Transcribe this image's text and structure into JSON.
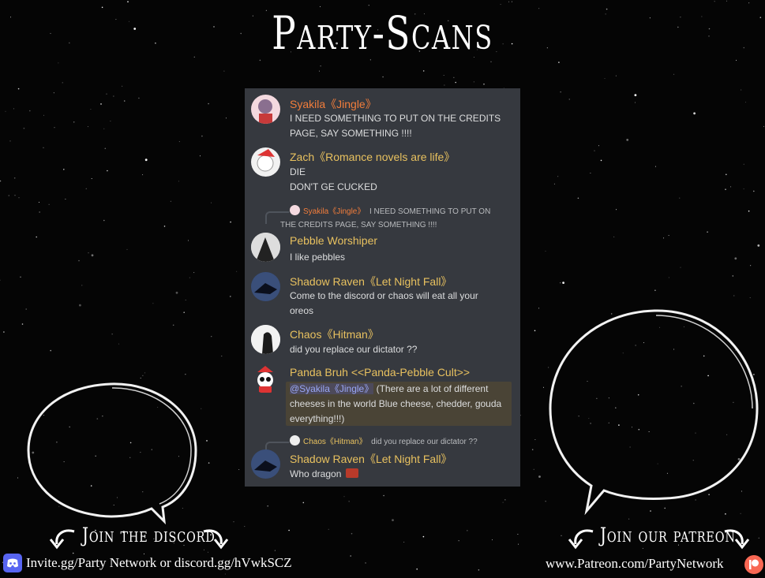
{
  "header": {
    "title": "Party-Scans"
  },
  "chat": {
    "messages": [
      {
        "user": "Syakila《Jingle》",
        "color": "#f27d3b",
        "lines": [
          "I NEED SOMETHING TO PUT ON THE CREDITS",
          "PAGE, SAY SOMETHING !!!!"
        ]
      },
      {
        "user": "Zach《Romance novels are life》",
        "color": "#e8c15f",
        "lines": [
          "DIE",
          "DON'T GE CUCKED"
        ]
      },
      {
        "reply_user": "Syakila《Jingle》",
        "reply_text_1": "I NEED SOMETHING TO PUT ON",
        "reply_text_2": "THE CREDITS PAGE, SAY SOMETHING !!!!",
        "user": "Pebble Worshiper",
        "color": "#e8c15f",
        "lines": [
          "I like pebbles"
        ]
      },
      {
        "user": "Shadow Raven《Let Night Fall》",
        "color": "#e8c15f",
        "lines": [
          "Come to the discord or chaos will eat all your",
          "oreos"
        ]
      },
      {
        "user": "Chaos《Hitman》",
        "color": "#e8c15f",
        "lines": [
          "did you replace our dictator ??"
        ]
      },
      {
        "user": "Panda Bruh <<Panda-Pebble Cult>>",
        "color": "#e8c15f",
        "mention": "@Syakila《Jingle》",
        "line1_rest": " (There are a lot of different",
        "line2": "cheeses in the world Blue cheese, chedder, gouda",
        "line3": "everything!!!)"
      },
      {
        "reply_user": "Chaos《Hitman》",
        "reply_text": "did you replace our dictator ??",
        "user": "Shadow Raven《Let Night Fall》",
        "color": "#e8c15f",
        "lines": [
          "Who dragon"
        ]
      }
    ]
  },
  "discord": {
    "cta": "Join the discord",
    "link": "Invite.gg/Party Network or discord.gg/hVwkSCZ",
    "icon": "discord-icon"
  },
  "patreon": {
    "cta": "Join our patreon",
    "link": "www.Patreon.com/PartyNetwork",
    "icon": "patreon-icon"
  },
  "colors": {
    "chat_bg": "#36393f",
    "orange_name": "#f27d3b",
    "gold_name": "#e8c15f",
    "discord": "#5865f2",
    "patreon": "#f96854"
  }
}
